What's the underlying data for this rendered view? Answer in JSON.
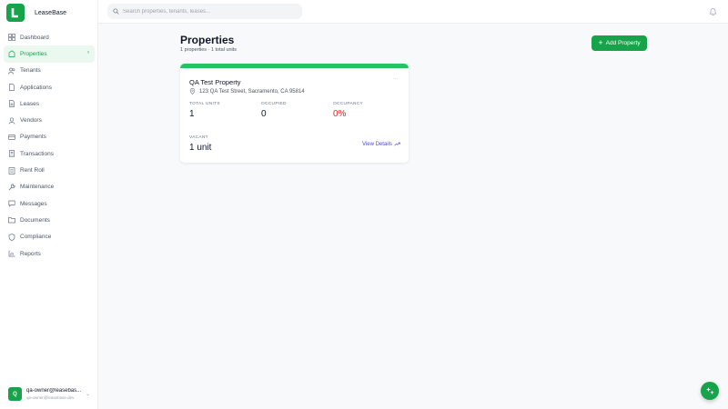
{
  "app": {
    "name": "LeaseBase",
    "logo_letter": "L"
  },
  "sidebar": {
    "items": [
      {
        "label": "Dashboard",
        "icon": "grid-icon"
      },
      {
        "label": "Properties",
        "icon": "building-icon",
        "active": true
      },
      {
        "label": "Tenants",
        "icon": "users-icon"
      },
      {
        "label": "Applications",
        "icon": "file-icon"
      },
      {
        "label": "Leases",
        "icon": "document-icon"
      },
      {
        "label": "Vendors",
        "icon": "user-icon"
      },
      {
        "label": "Payments",
        "icon": "card-icon"
      },
      {
        "label": "Transactions",
        "icon": "receipt-icon"
      },
      {
        "label": "Rent Roll",
        "icon": "list-icon"
      },
      {
        "label": "Maintenance",
        "icon": "wrench-icon"
      },
      {
        "label": "Messages",
        "icon": "message-icon"
      },
      {
        "label": "Documents",
        "icon": "folder-icon"
      },
      {
        "label": "Compliance",
        "icon": "shield-icon"
      },
      {
        "label": "Reports",
        "icon": "chart-icon"
      }
    ],
    "active_chevron": "›"
  },
  "user": {
    "initial": "Q",
    "name": "qa-owner@leasebas...",
    "email": "qa-owner@leasebase.dev"
  },
  "search": {
    "placeholder": "Search properties, tenants, leases..."
  },
  "page": {
    "title": "Properties",
    "subtitle": "1 properties · 1 total units",
    "add_button": "Add Property"
  },
  "card": {
    "name": "QA Test Property",
    "address": "123 QA Test Street, Sacramento, CA 95814",
    "stats": {
      "total_units_label": "TOTAL UNITS",
      "total_units_value": "1",
      "occupied_label": "OCCUPIED",
      "occupied_value": "0",
      "occupancy_label": "OCCUPANCY",
      "occupancy_value": "0%",
      "vacant_label": "VACANT",
      "vacant_value": "1 unit"
    },
    "view_link": "View Details"
  },
  "colors": {
    "accent": "#16a34a",
    "occupancy_red": "#dc2626",
    "link": "#4f46e5"
  }
}
